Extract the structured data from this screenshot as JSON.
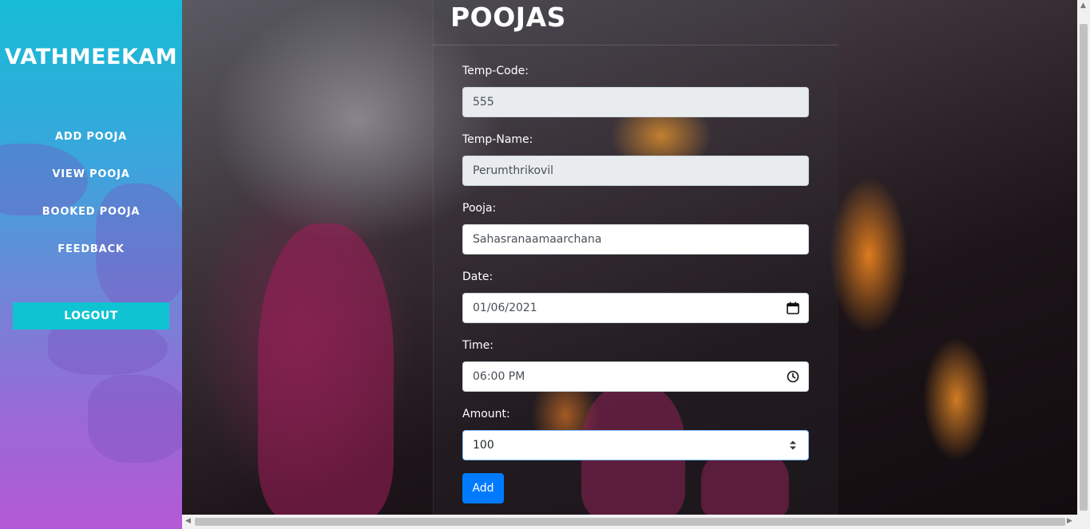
{
  "sidebar": {
    "brand": "VATHMEEKAM",
    "nav": [
      {
        "label": "ADD POOJA"
      },
      {
        "label": "VIEW POOJA"
      },
      {
        "label": "BOOKED POOJA"
      },
      {
        "label": "FEEDBACK"
      }
    ],
    "logout_label": "LOGOUT"
  },
  "main": {
    "title": "POOJAS",
    "form": {
      "temp_code": {
        "label": "Temp-Code:",
        "value": "555"
      },
      "temp_name": {
        "label": "Temp-Name:",
        "value": "Perumthrikovil"
      },
      "pooja": {
        "label": "Pooja:",
        "value": "Sahasranaamaarchana"
      },
      "date": {
        "label": "Date:",
        "value": "01/06/2021"
      },
      "time": {
        "label": "Time:",
        "value": "06:00 PM"
      },
      "amount": {
        "label": "Amount:",
        "value": "100"
      },
      "submit_label": "Add"
    }
  },
  "colors": {
    "sidebar_top": "#17bcd6",
    "sidebar_bottom": "#b45ad4",
    "logout_bg": "#10c3d2",
    "add_button": "#007bff"
  },
  "icons": {
    "date_field": "calendar-icon",
    "time_field": "clock-icon",
    "amount_field": "spinner-icon"
  }
}
